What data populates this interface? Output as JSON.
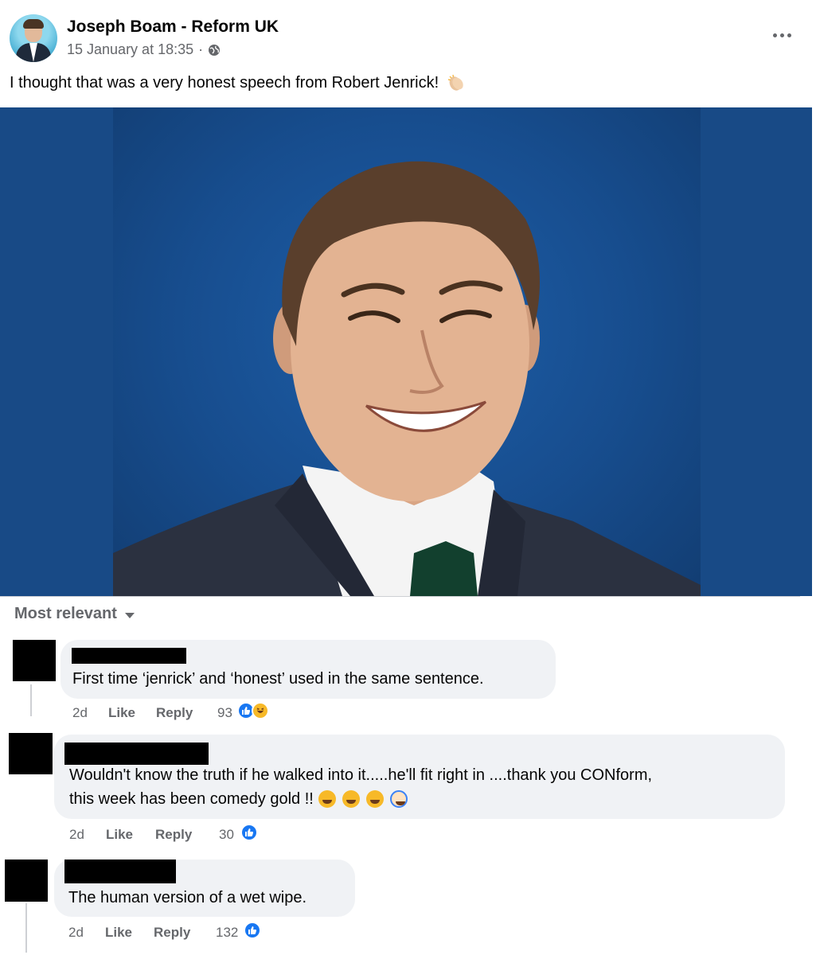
{
  "post": {
    "author": "Joseph Boam - Reform UK",
    "timestamp": "15 January at 18:35",
    "separator": "·",
    "audience_icon": "globe-icon",
    "text": "I thought that was a very honest speech from Robert Jenrick!",
    "text_emoji": "clapping-hands-icon"
  },
  "comments_section": {
    "sort_label": "Most relevant"
  },
  "comments": [
    {
      "text": "First time ‘jenrick’ and ‘honest’ used in the same sentence.",
      "time": "2d",
      "like_label": "Like",
      "reply_label": "Reply",
      "reaction_count": "93",
      "reactions": [
        "like",
        "haha"
      ]
    },
    {
      "text_line1": "Wouldn't know the truth if he walked into it.....he'll fit right in ....thank you CONform,",
      "text_line2": "this week has been comedy gold !!",
      "text_emojis": [
        "rolling-laughing-icon",
        "rolling-laughing-icon",
        "rolling-laughing-icon",
        "clown-face-icon"
      ],
      "time": "2d",
      "like_label": "Like",
      "reply_label": "Reply",
      "reaction_count": "30",
      "reactions": [
        "like"
      ]
    },
    {
      "text": "The human version of a wet wipe.",
      "time": "2d",
      "like_label": "Like",
      "reply_label": "Reply",
      "reaction_count": "132",
      "reactions": [
        "like"
      ]
    }
  ],
  "colors": {
    "secondary_text": "#65676b",
    "bubble": "#f0f2f5",
    "like_blue": "#1877f2",
    "photo_background": "#184a86"
  }
}
